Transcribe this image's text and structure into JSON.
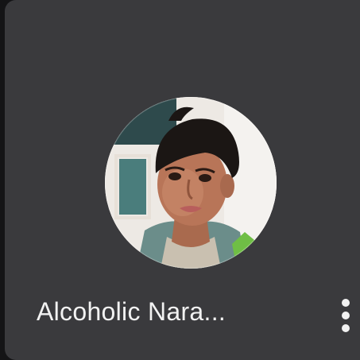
{
  "participant": {
    "name": "Alcoholic Nara..."
  },
  "icons": {
    "more": "more-vertical-icon",
    "avatar": "participant-avatar"
  },
  "colors": {
    "tile_background": "#3a3a3d",
    "page_background": "#141416",
    "text": "#f2f2f2"
  }
}
